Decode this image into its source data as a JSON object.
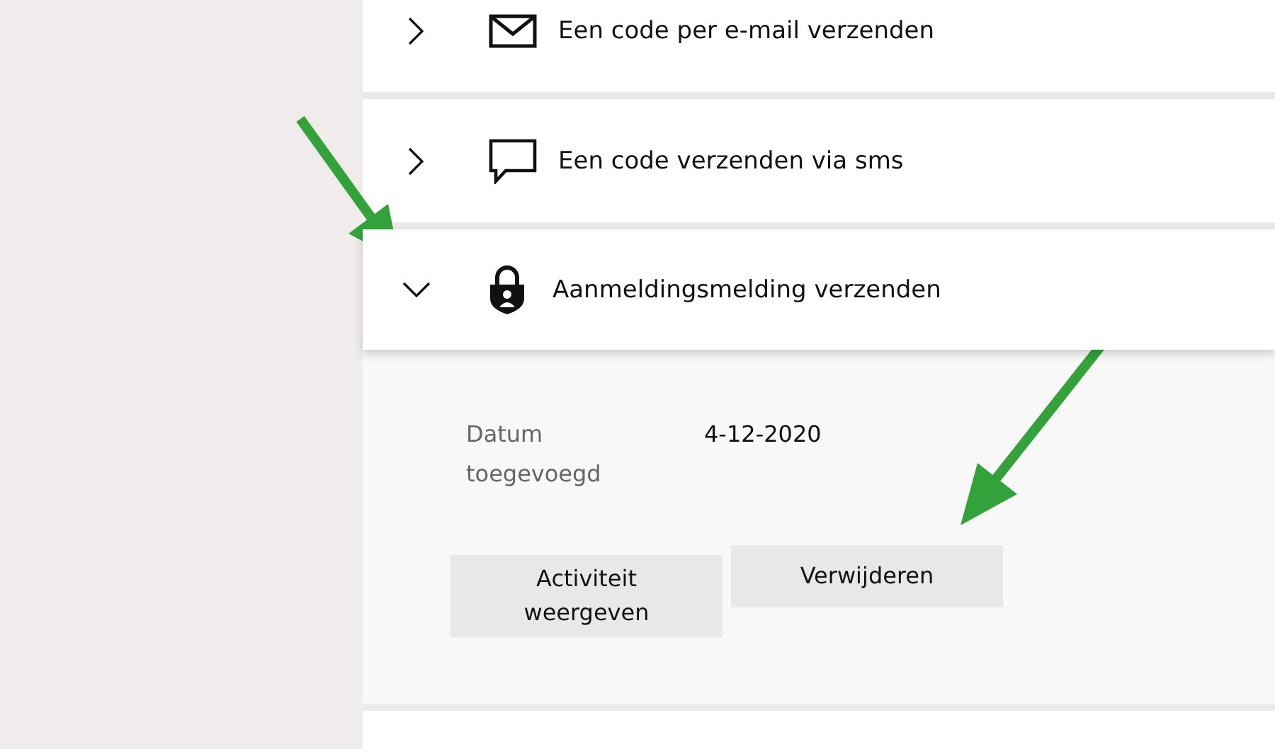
{
  "methods": [
    {
      "kind": "mail",
      "label": "Een code per e-mail verzenden",
      "expanded": false
    },
    {
      "kind": "chat",
      "label": "Een code verzenden via sms",
      "expanded": false
    },
    {
      "kind": "lock",
      "label": "Aanmeldingsmelding verzenden",
      "expanded": true,
      "details": [
        {
          "label": "Datum toegevoegd",
          "value": "4-12-2020"
        }
      ],
      "buttons": [
        "Activiteit weergeven",
        "Verwijderen"
      ]
    },
    {
      "kind": "partial",
      "expanded": false
    }
  ]
}
